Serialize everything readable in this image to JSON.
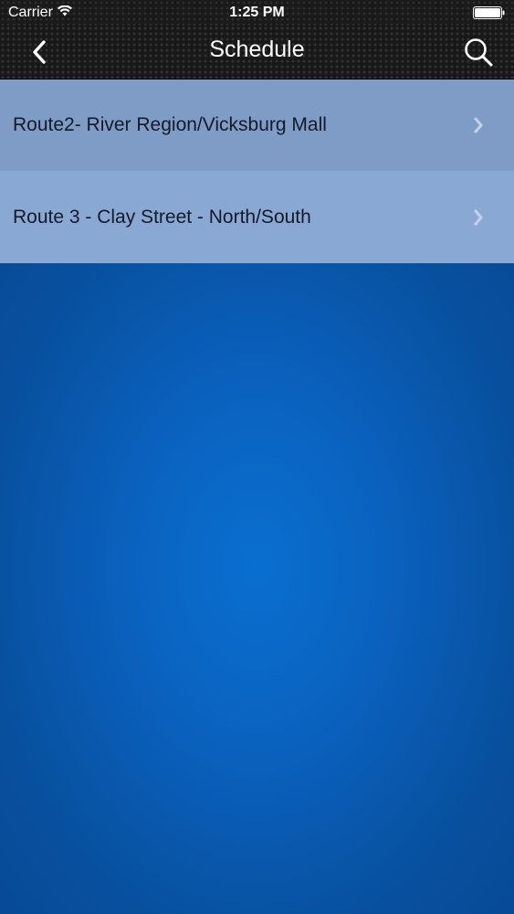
{
  "status_bar": {
    "carrier": "Carrier",
    "time": "1:25 PM",
    "wifi_icon": "wifi-icon",
    "battery_icon": "battery-icon"
  },
  "nav_bar": {
    "title": "Schedule",
    "back_icon": "chevron-left-icon",
    "search_icon": "search-icon"
  },
  "routes": [
    {
      "label": "Route2- River Region/Vicksburg Mall",
      "accessory_icon": "chevron-right-icon"
    },
    {
      "label": "Route 3 - Clay Street - North/South",
      "accessory_icon": "chevron-right-icon"
    }
  ],
  "colors": {
    "nav_background": "#181818",
    "row_1_background": "#7f9cc6",
    "row_2_background": "#8aa8d4",
    "page_background": "#0a62bf",
    "row_text": "#141b28",
    "chevron": "#c3d2e8"
  }
}
